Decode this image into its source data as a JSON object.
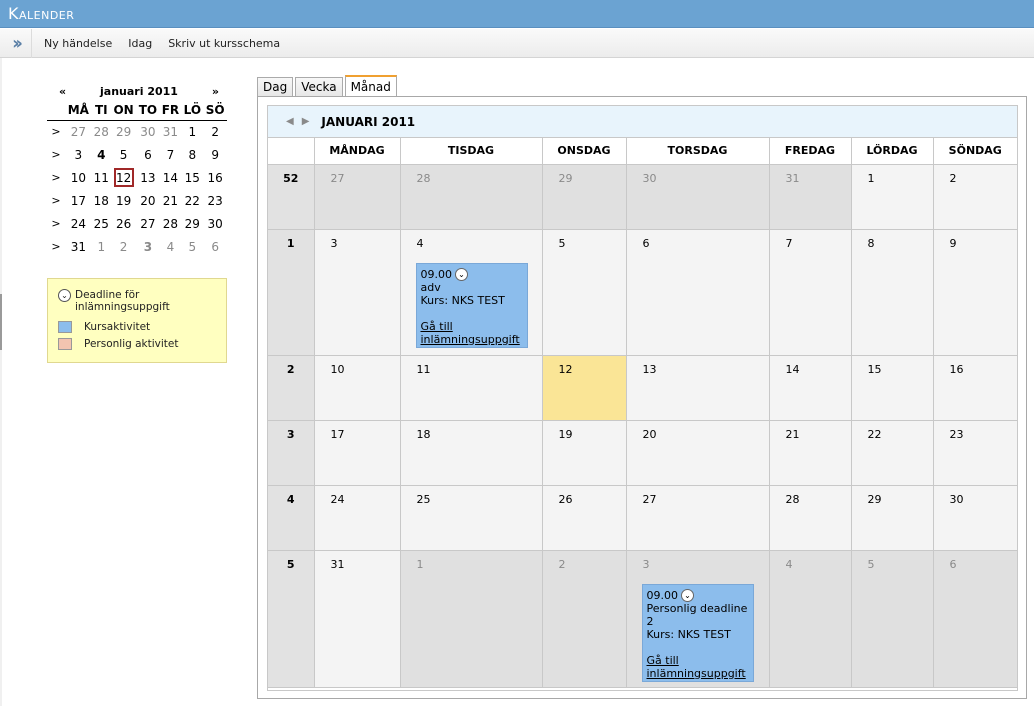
{
  "window": {
    "title": "Kalender"
  },
  "toolbar": {
    "items": [
      "Ny händelse",
      "Idag",
      "Skriv ut kursschema"
    ]
  },
  "mini_calendar": {
    "prev": "«",
    "next": "»",
    "title": "januari 2011",
    "weekdays": [
      "MÅ",
      "TI",
      "ON",
      "TO",
      "FR",
      "LÖ",
      "SÖ"
    ],
    "week_marker": ">",
    "weeks": [
      [
        "27",
        "28",
        "29",
        "30",
        "31",
        "1",
        "2"
      ],
      [
        "3",
        "4",
        "5",
        "6",
        "7",
        "8",
        "9"
      ],
      [
        "10",
        "11",
        "12",
        "13",
        "14",
        "15",
        "16"
      ],
      [
        "17",
        "18",
        "19",
        "20",
        "21",
        "22",
        "23"
      ],
      [
        "24",
        "25",
        "26",
        "27",
        "28",
        "29",
        "30"
      ],
      [
        "31",
        "1",
        "2",
        "3",
        "4",
        "5",
        "6"
      ]
    ]
  },
  "legend": {
    "deadline": "Deadline för inlämningsuppgift",
    "course": "Kursaktivitet",
    "personal": "Personlig aktivitet",
    "course_color": "#8cbdec",
    "personal_color": "#f3c4b0"
  },
  "tabs": [
    "Dag",
    "Vecka",
    "Månad"
  ],
  "active_tab": "Månad",
  "month": {
    "title": "JANUARI 2011",
    "weekdays": [
      "MÅNDAG",
      "TISDAG",
      "ONSDAG",
      "TORSDAG",
      "FREDAG",
      "LÖRDAG",
      "SÖNDAG"
    ],
    "weeks": [
      {
        "no": "52",
        "days": [
          "27",
          "28",
          "29",
          "30",
          "31",
          "1",
          "2"
        ]
      },
      {
        "no": "1",
        "days": [
          "3",
          "4",
          "5",
          "6",
          "7",
          "8",
          "9"
        ]
      },
      {
        "no": "2",
        "days": [
          "10",
          "11",
          "12",
          "13",
          "14",
          "15",
          "16"
        ]
      },
      {
        "no": "3",
        "days": [
          "17",
          "18",
          "19",
          "20",
          "21",
          "22",
          "23"
        ]
      },
      {
        "no": "4",
        "days": [
          "24",
          "25",
          "26",
          "27",
          "28",
          "29",
          "30"
        ]
      },
      {
        "no": "5",
        "days": [
          "31",
          "1",
          "2",
          "3",
          "4",
          "5",
          "6"
        ]
      }
    ],
    "events": [
      {
        "time": "09.00",
        "title": "adv",
        "course": "Kurs: NKS TEST",
        "link": "Gå till inlämningsuppgift"
      },
      {
        "time": "09.00",
        "title": "Personlig deadline 2",
        "course": "Kurs: NKS TEST",
        "link": "Gå till inlämningsuppgift"
      }
    ]
  },
  "colors": {
    "today": "#fae596",
    "title_bar": "#6ba3d2",
    "tab_accent": "#f0a030"
  }
}
